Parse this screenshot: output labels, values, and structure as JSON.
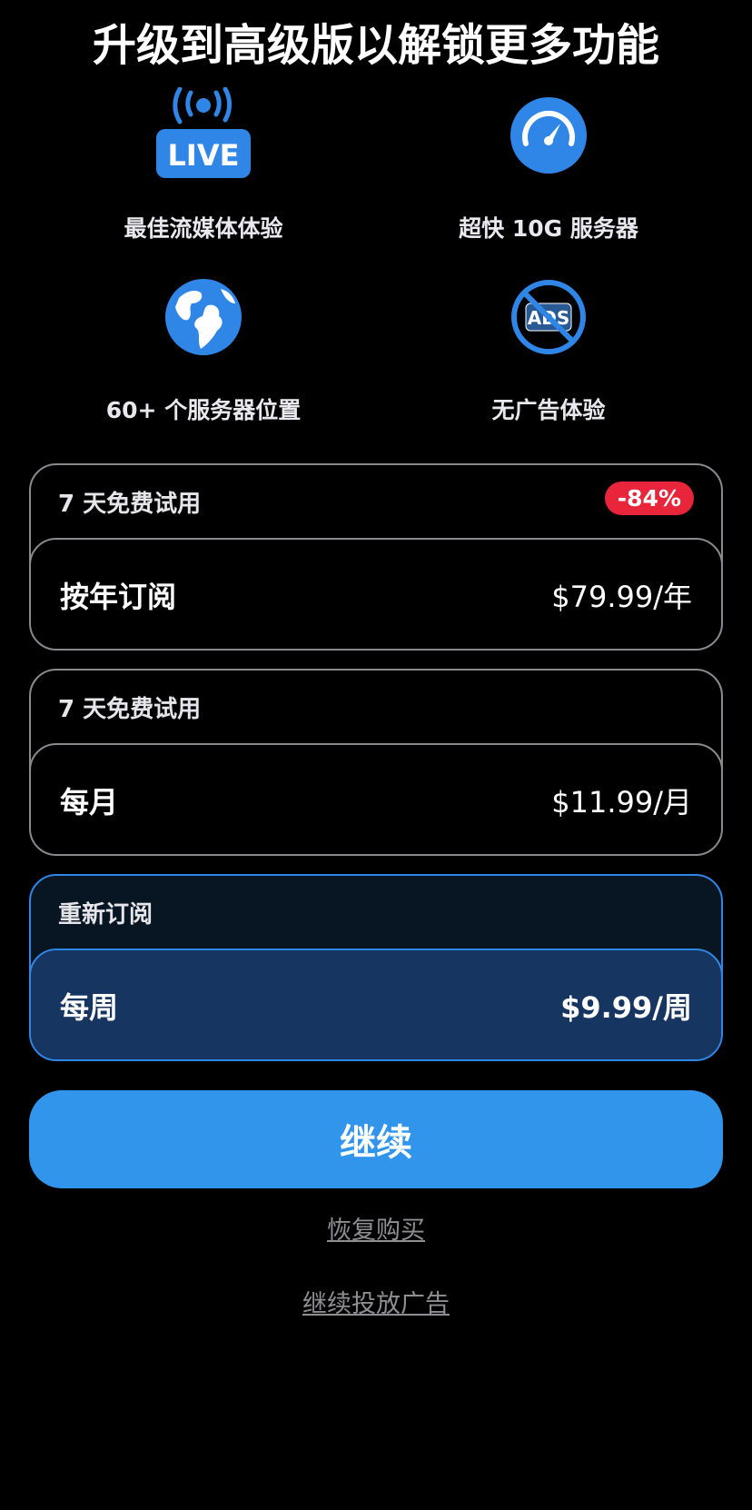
{
  "header": {
    "title": "升级到高级版以解锁更多功能"
  },
  "features": [
    {
      "icon": "live-stream-icon",
      "label": "最佳流媒体体验",
      "icon_text": "LIVE"
    },
    {
      "icon": "speedometer-icon",
      "label": "超快 10G 服务器"
    },
    {
      "icon": "globe-icon",
      "label": "60+ 个服务器位置"
    },
    {
      "icon": "no-ads-icon",
      "label": "无广告体验",
      "icon_text": "ADS"
    }
  ],
  "plans": [
    {
      "trial": "7 天免费试用",
      "badge": "-84%",
      "name": "按年订阅",
      "price": "$79.99/年",
      "selected": false
    },
    {
      "trial": "7 天免费试用",
      "name": "每月",
      "price": "$11.99/月",
      "selected": false
    },
    {
      "trial": "重新订阅",
      "name": "每周",
      "price": "$9.99/周",
      "selected": true
    }
  ],
  "actions": {
    "continue_label": "继续",
    "restore_label": "恢复购买",
    "continue_ads_label": "继续投放广告"
  },
  "colors": {
    "accent": "#3195ec",
    "badge": "#e8253a",
    "selected_inner": "#163560",
    "selected_outer": "#081624"
  }
}
